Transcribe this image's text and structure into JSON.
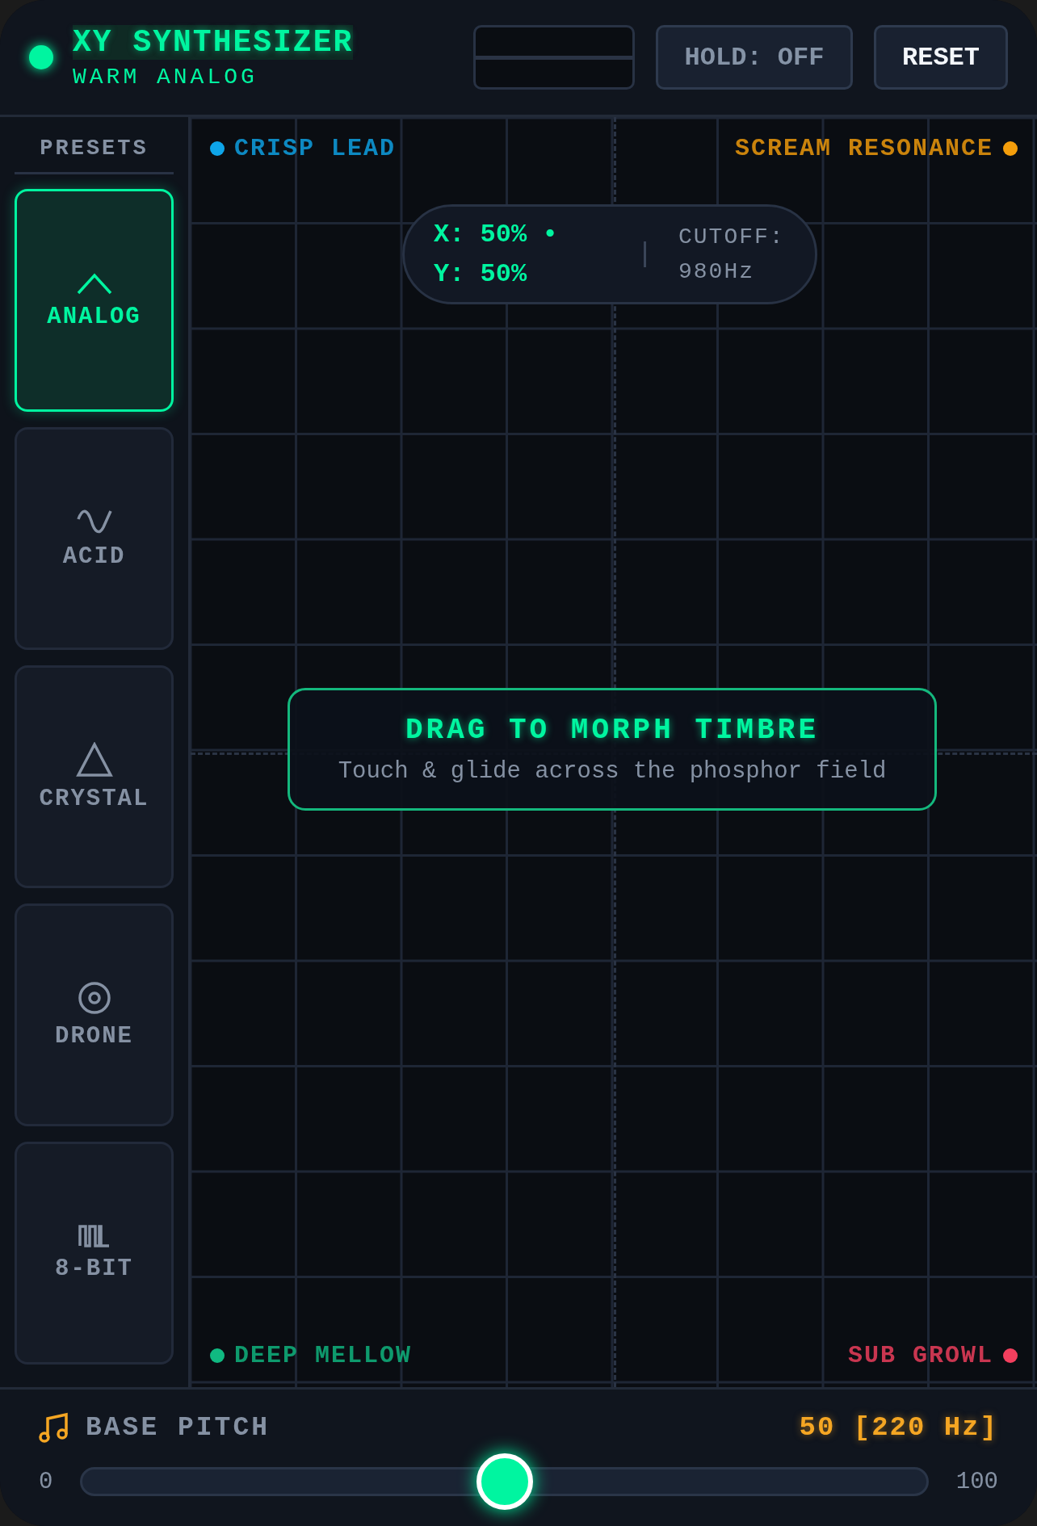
{
  "header": {
    "title": "XY SYNTHESIZER",
    "subtitle": "WARM ANALOG",
    "hold_button": "HOLD: OFF",
    "reset_button": "RESET"
  },
  "presets": {
    "heading": "PRESETS",
    "items": [
      {
        "label": "ANALOG",
        "kind": "peak",
        "selected": true
      },
      {
        "label": "ACID",
        "kind": "sine",
        "selected": false
      },
      {
        "label": "CRYSTAL",
        "kind": "triangle",
        "selected": false
      },
      {
        "label": "DRONE",
        "kind": "target",
        "selected": false
      },
      {
        "label": "8-BIT",
        "kind": "square",
        "selected": false
      }
    ]
  },
  "pad": {
    "corners": [
      {
        "label": "CRISP LEAD",
        "color": "#0ea5e9"
      },
      {
        "label": "SCREAM RESONANCE",
        "color": "#f59e0b"
      },
      {
        "label": "DEEP MELLOW",
        "color": "#10b981"
      },
      {
        "label": "SUB GROWL",
        "color": "#f43f5e"
      }
    ],
    "readout": {
      "x": "X: 50% •",
      "y": "Y: 50%",
      "cutoff_label": "CUTOFF:",
      "cutoff_value": "980Hz"
    },
    "hint": {
      "title": "DRAG TO MORPH TIMBRE",
      "text": "Touch & glide across the phosphor field"
    }
  },
  "pitch": {
    "label": "BASE PITCH",
    "value": "50 [220 Hz]",
    "min": "0",
    "max": "100",
    "level": 0.5
  }
}
